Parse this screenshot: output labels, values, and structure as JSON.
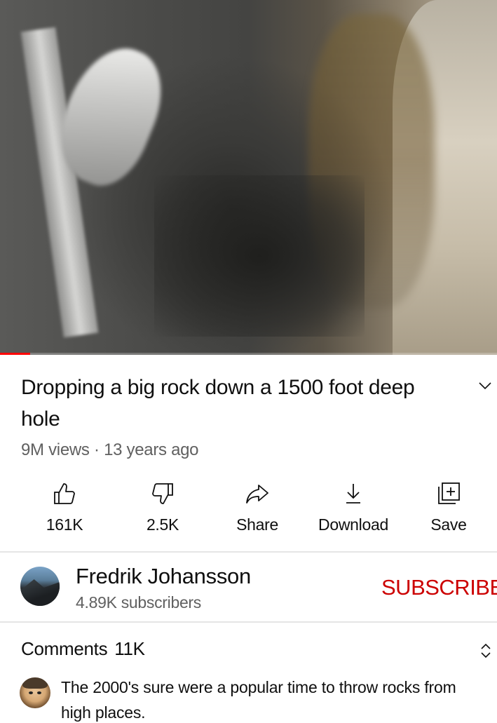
{
  "video": {
    "progress_fraction": 0.06
  },
  "title": "Dropping a big rock down a 1500 foot deep hole",
  "meta": {
    "views": "9M views",
    "separator": " · ",
    "age": "13 years ago"
  },
  "actions": [
    {
      "label": "161K",
      "icon": "thumbs-up-icon"
    },
    {
      "label": "2.5K",
      "icon": "thumbs-down-icon"
    },
    {
      "label": "Share",
      "icon": "share-arrow-icon"
    },
    {
      "label": "Download",
      "icon": "download-icon"
    },
    {
      "label": "Save",
      "icon": "add-to-playlist-icon"
    }
  ],
  "channel": {
    "name": "Fredrik Johansson",
    "subscribers": "4.89K subscribers",
    "subscribe_label": "SUBSCRIBE"
  },
  "comments": {
    "heading": "Comments",
    "count": "11K",
    "top_comment": "The 2000's sure were a popular time to throw rocks from high places."
  },
  "colors": {
    "subscribe": "#cc0000",
    "progress": "#ff0000",
    "secondary_text": "#606060"
  }
}
